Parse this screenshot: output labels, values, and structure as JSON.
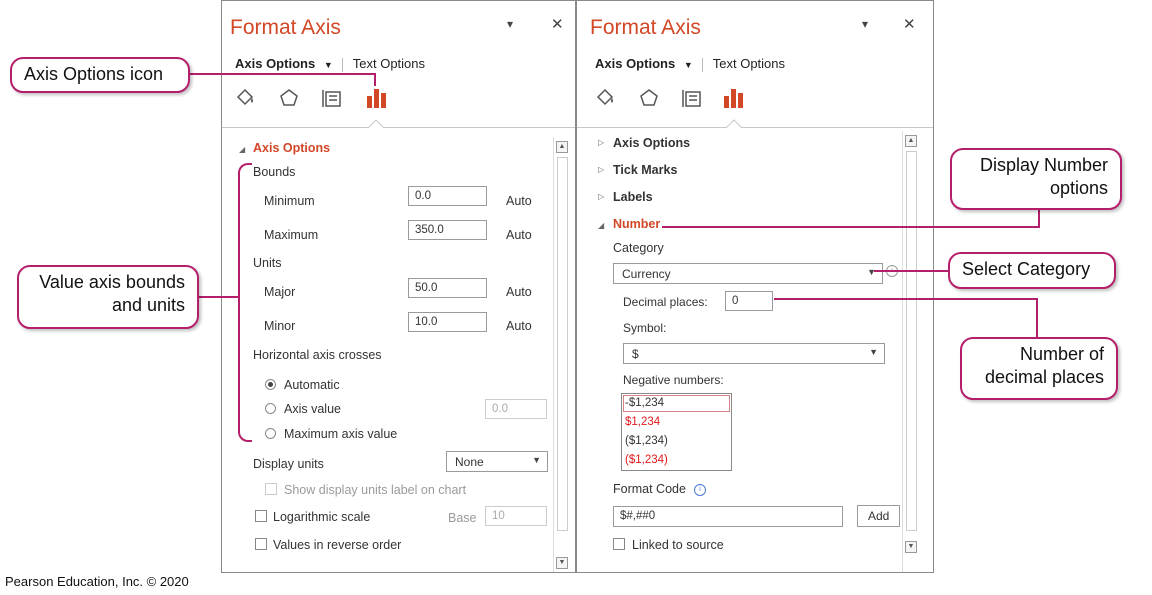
{
  "callouts": {
    "axis_options_icon": "Axis Options icon",
    "value_axis": "Value axis bounds and units",
    "display_number": "Display Number options",
    "select_category": "Select Category",
    "number_decimal": "Number of decimal places"
  },
  "footer": "Pearson Education, Inc. © 2020",
  "left_panel": {
    "title": "Format Axis",
    "tab_active": "Axis Options",
    "tab_other": "Text Options",
    "section": "Axis Options",
    "bounds_label": "Bounds",
    "minimum_label": "Minimum",
    "minimum_value": "0.0",
    "minimum_auto": "Auto",
    "maximum_label": "Maximum",
    "maximum_value": "350.0",
    "maximum_auto": "Auto",
    "units_label": "Units",
    "major_label": "Major",
    "major_value": "50.0",
    "major_auto": "Auto",
    "minor_label": "Minor",
    "minor_value": "10.0",
    "minor_auto": "Auto",
    "hcross_label": "Horizontal axis crosses",
    "radio_automatic": "Automatic",
    "radio_axis_value": "Axis value",
    "axis_value": "0.0",
    "radio_max": "Maximum axis value",
    "display_units_label": "Display units",
    "display_units_value": "None",
    "show_units_label": "Show display units label on chart",
    "log_scale_label": "Logarithmic scale",
    "base_label": "Base",
    "base_value": "10",
    "reverse_label": "Values in reverse order"
  },
  "right_panel": {
    "title": "Format Axis",
    "tab_active": "Axis Options",
    "tab_other": "Text Options",
    "sec_axis_options": "Axis Options",
    "sec_tick_marks": "Tick Marks",
    "sec_labels": "Labels",
    "sec_number": "Number",
    "category_label": "Category",
    "category_value": "Currency",
    "decimal_label": "Decimal places:",
    "decimal_value": "0",
    "symbol_label": "Symbol:",
    "symbol_value": "$",
    "negative_label": "Negative numbers:",
    "negatives": [
      "-$1,234",
      "$1,234",
      "($1,234)",
      "($1,234)"
    ],
    "format_code_label": "Format Code",
    "format_code_value": "$#,##0",
    "add_label": "Add",
    "linked_label": "Linked to source"
  },
  "colors": {
    "accent": "#d24726",
    "callout_border": "#b41f6b",
    "negative_red": "#e0191b"
  }
}
